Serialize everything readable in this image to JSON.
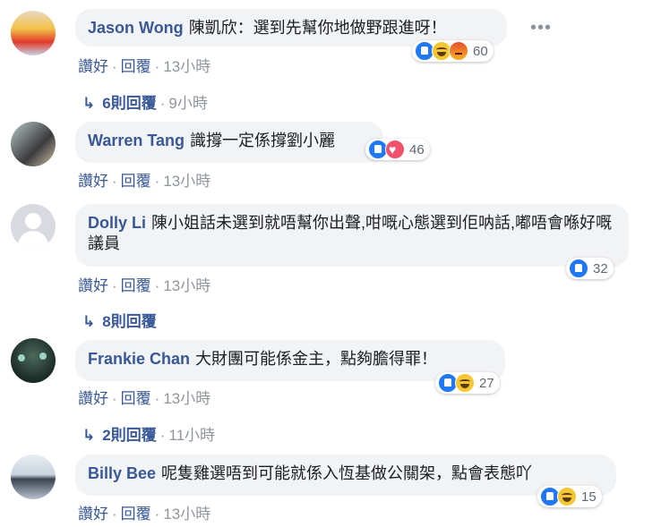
{
  "comments": [
    {
      "name": "Jason Wong",
      "text": "陳凱欣：選到先幫你地做野跟進呀！",
      "like": "讚好",
      "reply": "回覆",
      "time": "13小時",
      "reactions": [
        "like",
        "haha",
        "angry"
      ],
      "reaction_count": "60",
      "replies": "6則回覆",
      "replies_time": "9小時"
    },
    {
      "name": "Warren Tang",
      "text": "識撐一定係撐劉小麗",
      "like": "讚好",
      "reply": "回覆",
      "time": "13小時",
      "reactions": [
        "like",
        "love"
      ],
      "reaction_count": "46"
    },
    {
      "name": "Dolly Li",
      "text": "陳小姐話未選到就唔幫你出聲,咁嘅心態選到佢呐話,嘟唔會喺好嘅議員",
      "like": "讚好",
      "reply": "回覆",
      "time": "13小時",
      "reactions": [
        "like"
      ],
      "reaction_count": "32",
      "replies": "8則回覆"
    },
    {
      "name": "Frankie Chan",
      "text": "大財團可能係金主，點夠膽得罪！",
      "like": "讚好",
      "reply": "回覆",
      "time": "13小時",
      "reactions": [
        "like",
        "haha"
      ],
      "reaction_count": "27",
      "replies": "2則回覆",
      "replies_time": "11小時"
    },
    {
      "name": "Billy Bee",
      "text": "呢隻雞選唔到可能就係入恆基做公關架，點會表態吖",
      "like": "讚好",
      "reply": "回覆",
      "time": "13小時",
      "reactions": [
        "like",
        "haha"
      ],
      "reaction_count": "15"
    }
  ],
  "icons": {
    "more": "more-options-icon",
    "reply_arrow": "reply-arrow-icon"
  }
}
